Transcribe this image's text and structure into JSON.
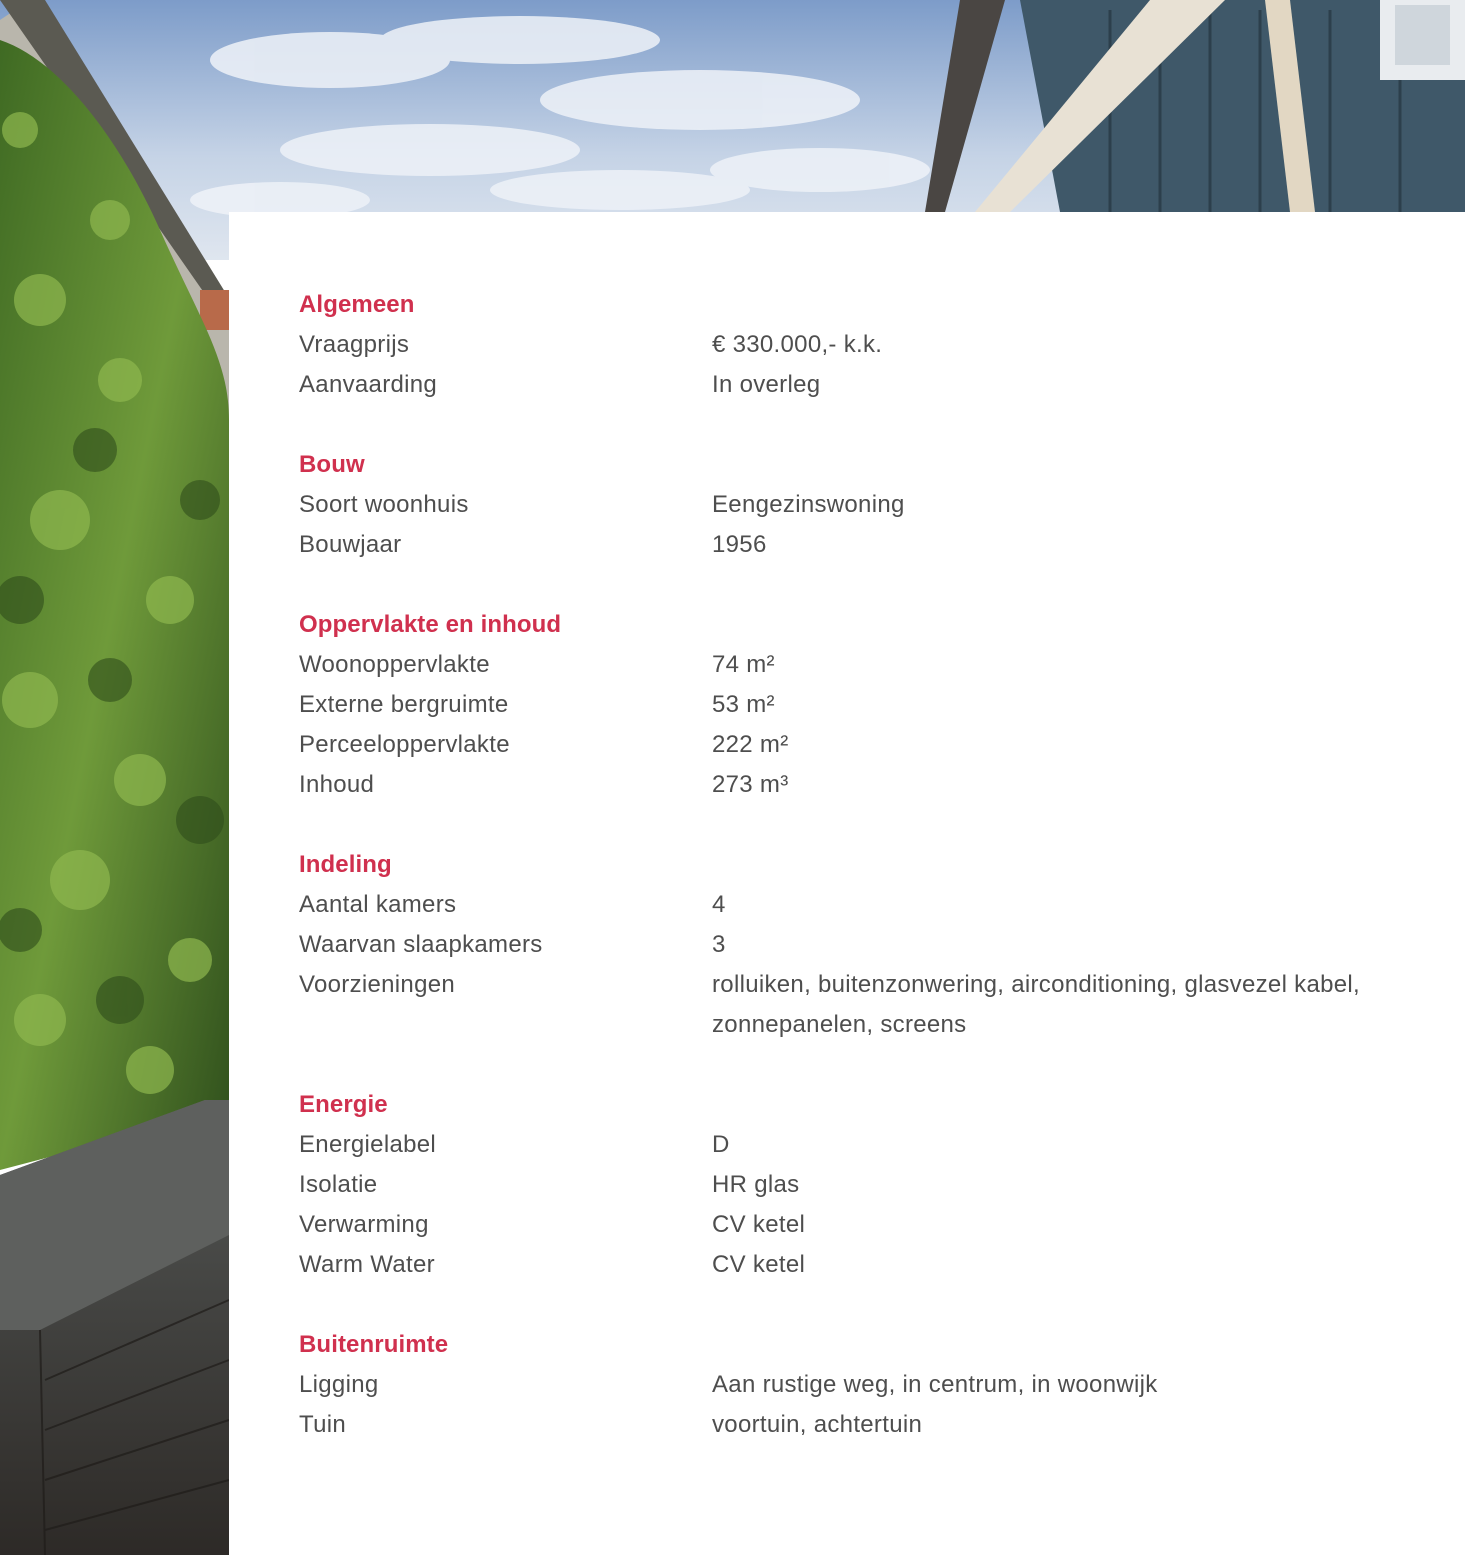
{
  "colors": {
    "heading": "#d0304e",
    "text": "#4e4e4e",
    "card": "#ffffff"
  },
  "sections": [
    {
      "title": "Algemeen",
      "rows": [
        {
          "label": "Vraagprijs",
          "value": "€ 330.000,- k.k."
        },
        {
          "label": "Aanvaarding",
          "value": "In overleg"
        }
      ]
    },
    {
      "title": "Bouw",
      "rows": [
        {
          "label": "Soort woonhuis",
          "value": "Eengezinswoning"
        },
        {
          "label": "Bouwjaar",
          "value": "1956"
        }
      ]
    },
    {
      "title": "Oppervlakte en inhoud",
      "rows": [
        {
          "label": "Woonoppervlakte",
          "value": "74 m²"
        },
        {
          "label": "Externe bergruimte",
          "value": "53 m²"
        },
        {
          "label": "Perceeloppervlakte",
          "value": "222 m²"
        },
        {
          "label": "Inhoud",
          "value": "273 m³"
        }
      ]
    },
    {
      "title": "Indeling",
      "rows": [
        {
          "label": "Aantal kamers",
          "value": "4"
        },
        {
          "label": "Waarvan slaapkamers",
          "value": "3"
        },
        {
          "label": "Voorzieningen",
          "value": "rolluiken, buitenzonwering, airconditioning, glasvezel kabel, zonnepanelen, screens"
        }
      ]
    },
    {
      "title": "Energie",
      "rows": [
        {
          "label": "Energielabel",
          "value": "D"
        },
        {
          "label": "Isolatie",
          "value": "HR glas"
        },
        {
          "label": "Verwarming",
          "value": "CV ketel"
        },
        {
          "label": "Warm Water",
          "value": "CV ketel"
        }
      ]
    },
    {
      "title": "Buitenruimte",
      "rows": [
        {
          "label": "Ligging",
          "value": "Aan rustige weg, in centrum, in woonwijk"
        },
        {
          "label": "Tuin",
          "value": "voortuin, achtertuin"
        }
      ]
    }
  ]
}
